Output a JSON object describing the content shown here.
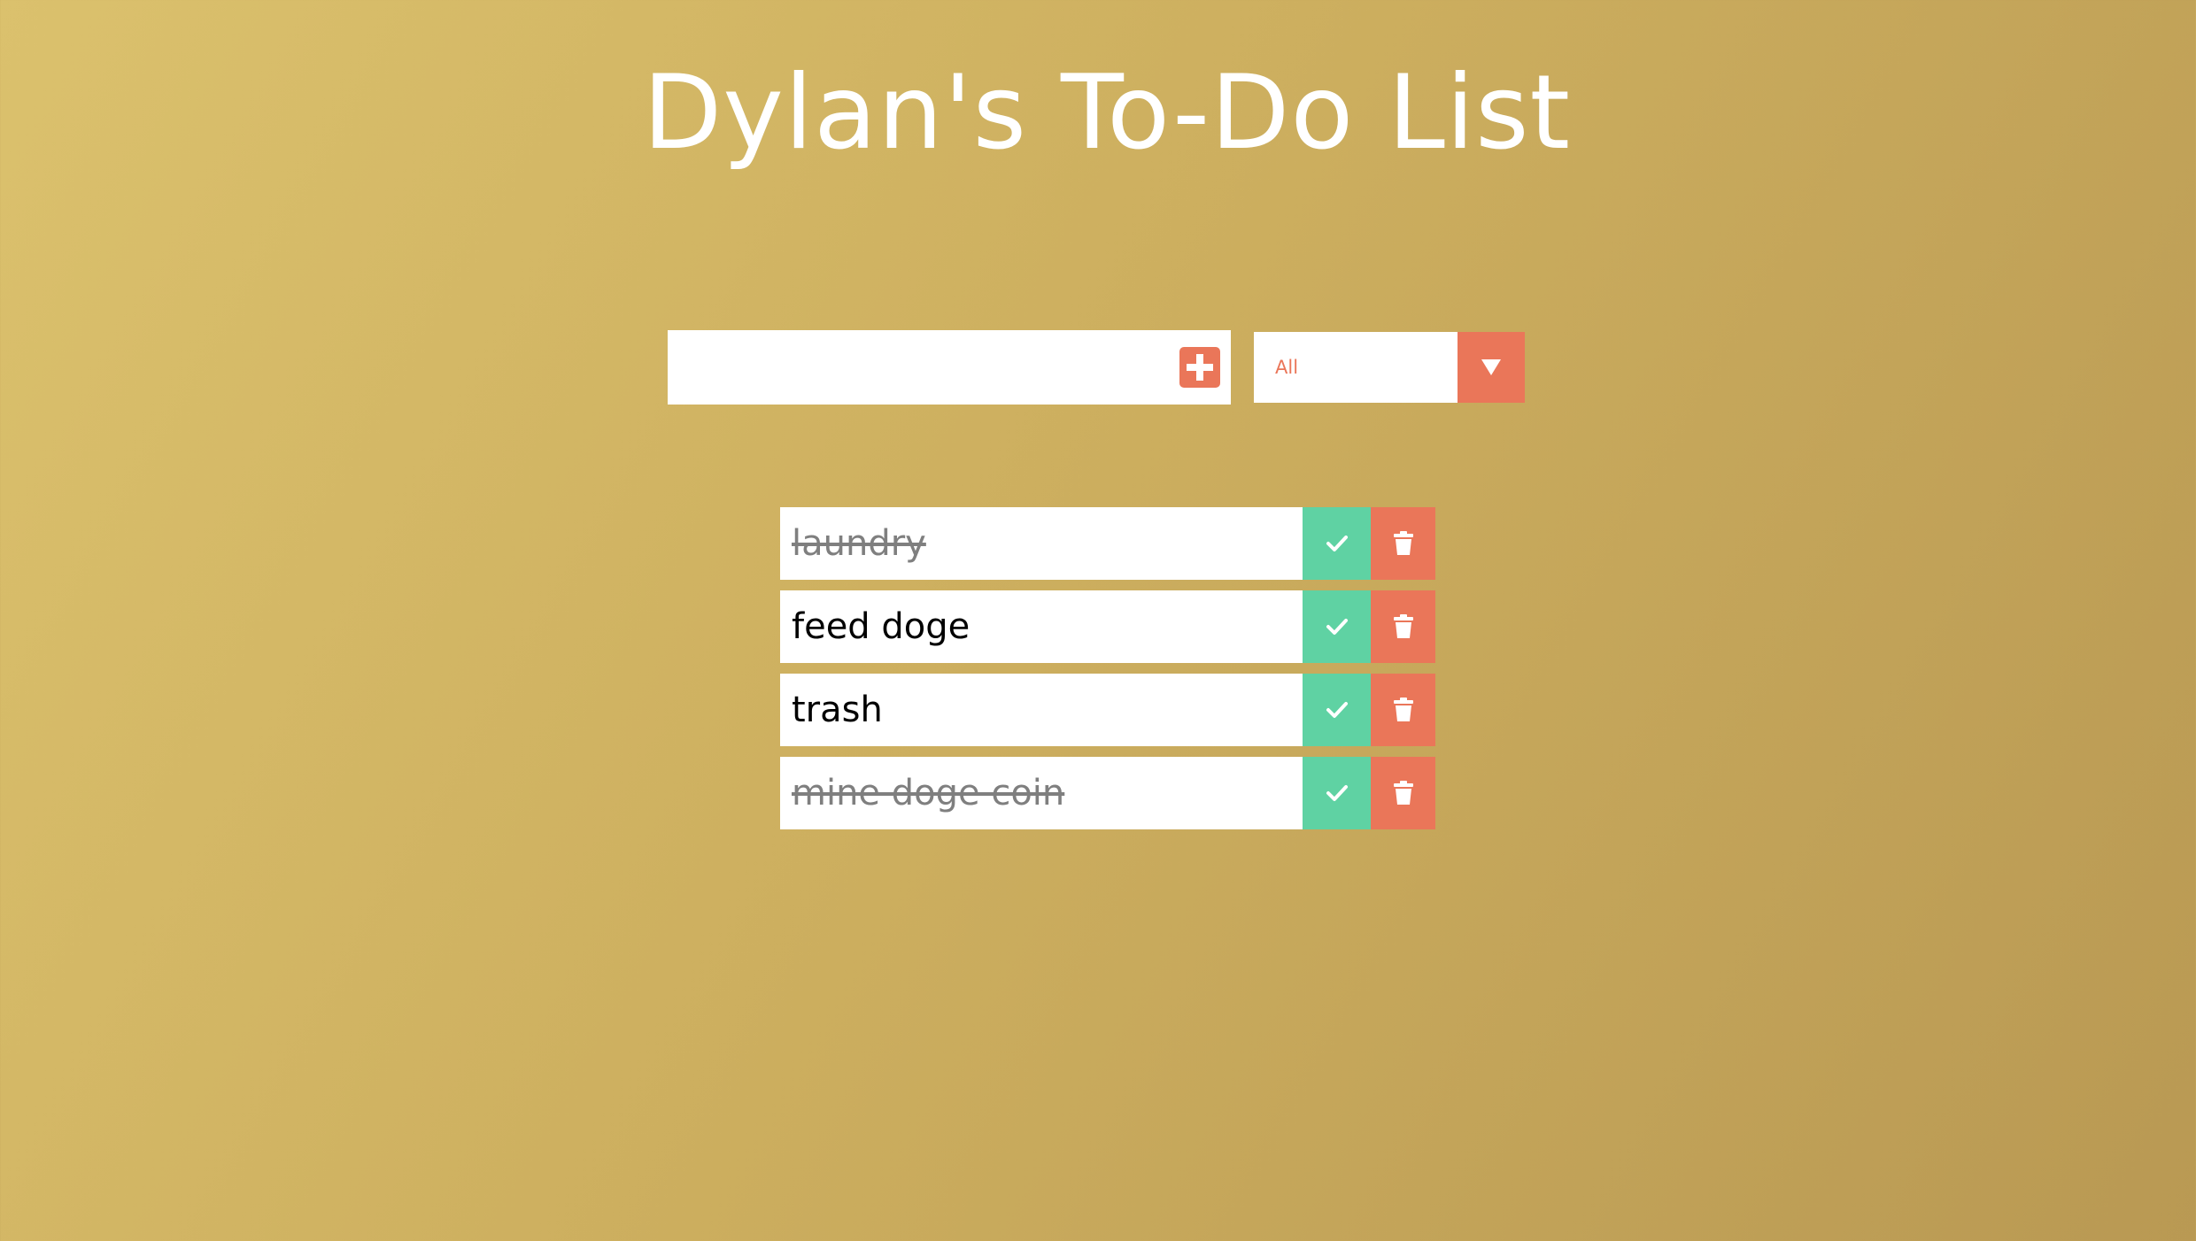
{
  "header": {
    "title": "Dylan's To-Do List"
  },
  "form": {
    "input_value": "",
    "input_placeholder": "",
    "add_icon": "plus-square-icon",
    "filter_selected": "All",
    "filter_icon": "triangle-down-icon"
  },
  "todos": [
    {
      "text": "laundry",
      "completed": true
    },
    {
      "text": "feed doge",
      "completed": false
    },
    {
      "text": "trash",
      "completed": false
    },
    {
      "text": "mine doge coin",
      "completed": true
    }
  ],
  "item_icons": {
    "complete": "check-icon",
    "delete": "trash-icon"
  },
  "colors": {
    "accent": "#ea7659",
    "complete": "#5fd2a3",
    "background_start": "#dbc16d",
    "background_end": "#b99953",
    "completed_text": "#7f7f7f"
  }
}
